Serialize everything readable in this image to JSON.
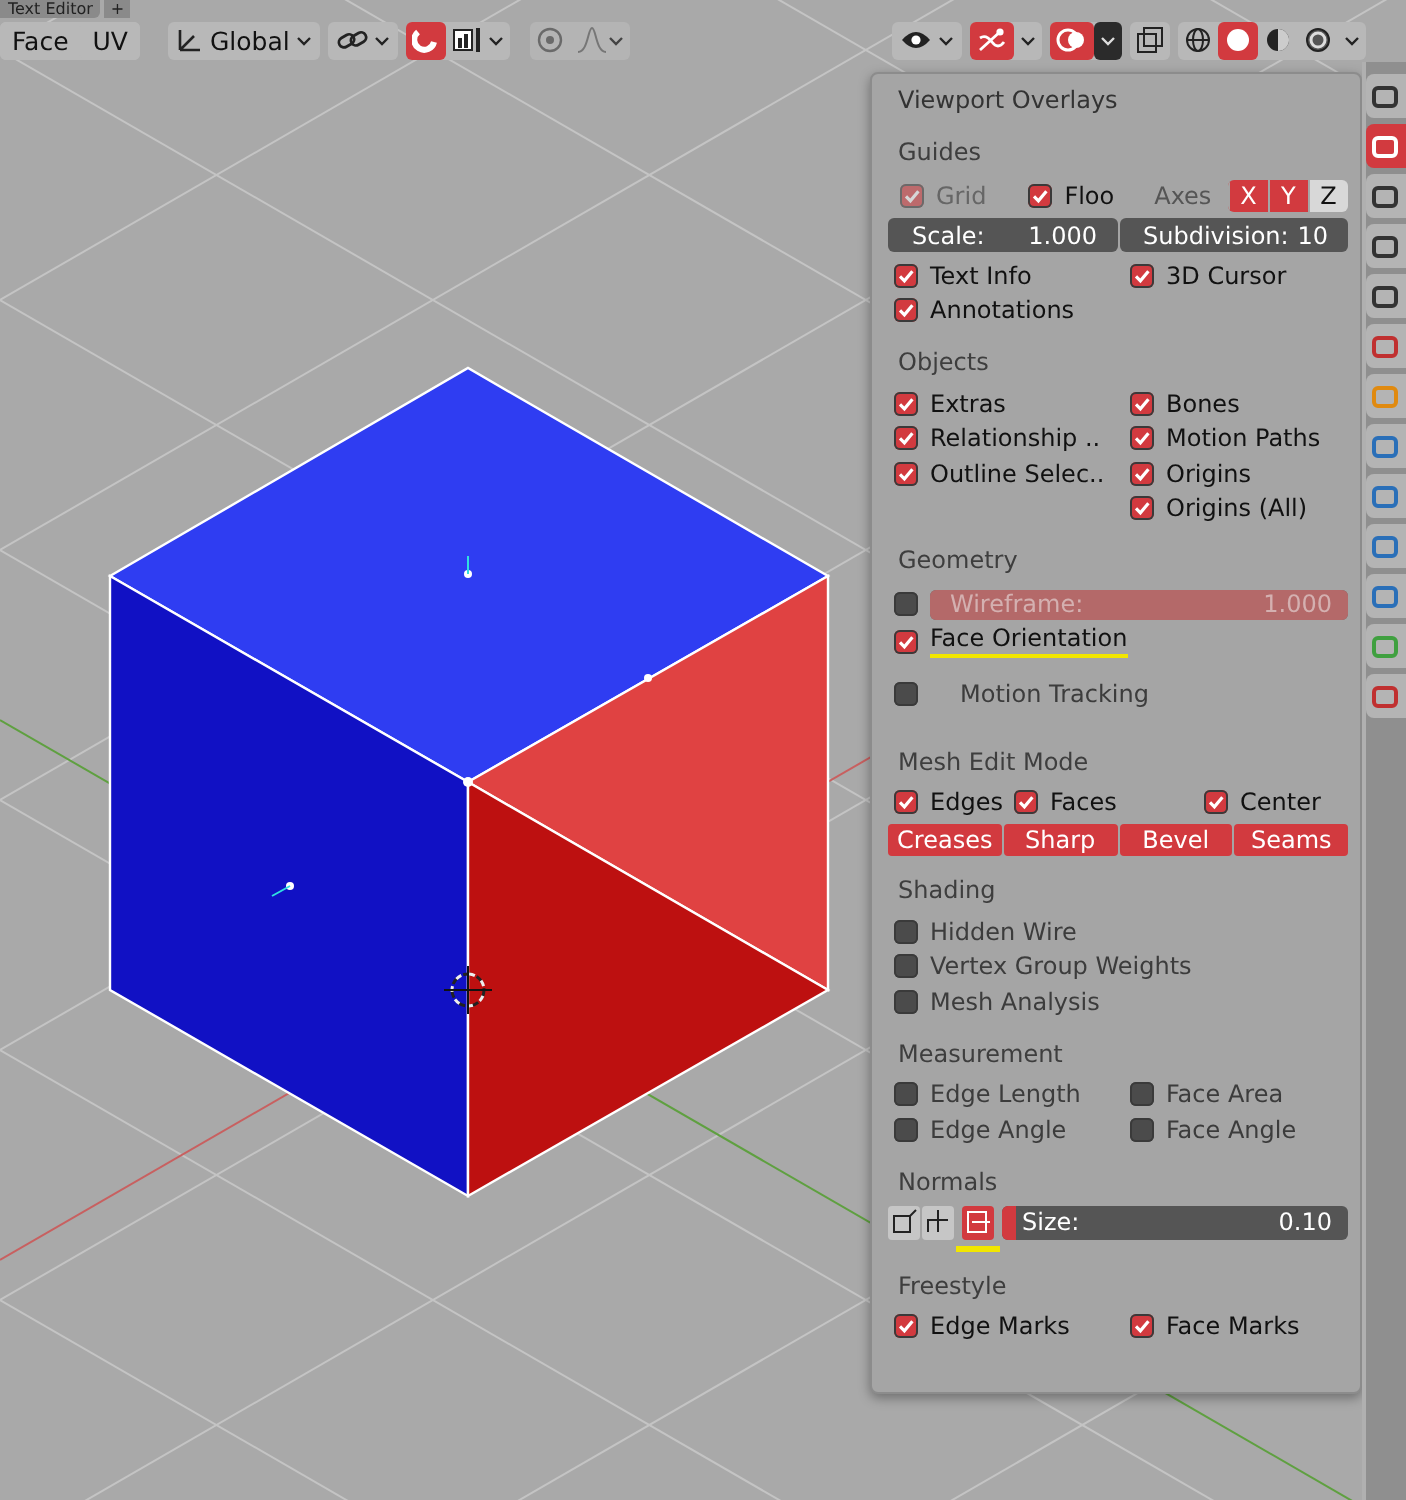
{
  "editor_tabs": [
    {
      "label": "Text Editor"
    }
  ],
  "add_tab": "+",
  "header": {
    "mode_buttons": [
      {
        "label": "Face"
      },
      {
        "label": "UV"
      }
    ],
    "orientation": "Global",
    "snap_on": true,
    "proportional_on": false,
    "gizmos_on": true,
    "overlays_on": true,
    "xray_on": false,
    "shading_modes": [
      {
        "selected": false
      },
      {
        "selected": true
      },
      {
        "selected": false
      },
      {
        "selected": false
      }
    ]
  },
  "overlays": {
    "title": "Viewport Overlays",
    "sections": [
      {
        "title": "Guides",
        "rows": [
          {
            "kind": "guides",
            "grid": {
              "label": "Grid",
              "checked": true,
              "disabled": true
            },
            "floor": {
              "label": "Floo",
              "checked": true,
              "disabled": false
            },
            "axes_label": "Axes",
            "axes": [
              {
                "label": "X",
                "on": true
              },
              {
                "label": "Y",
                "on": true
              },
              {
                "label": "Z",
                "on": false
              }
            ]
          },
          {
            "kind": "fields",
            "fields": [
              {
                "label": "Scale:",
                "value": "1.000"
              },
              {
                "label": "Subdivision:",
                "value": "10"
              }
            ]
          },
          {
            "kind": "checks",
            "items": [
              {
                "label": "Text Info",
                "checked": true
              },
              {
                "label": "3D Cursor",
                "checked": true
              }
            ]
          },
          {
            "kind": "checks",
            "items": [
              {
                "label": "Annotations",
                "checked": true
              }
            ]
          }
        ]
      },
      {
        "title": "Objects",
        "rows": [
          {
            "kind": "columns",
            "columns": [
              [
                {
                  "label": "Extras",
                  "checked": true
                },
                {
                  "label": "Relationship ..",
                  "checked": true
                },
                {
                  "label": "Outline Selec..",
                  "checked": true
                }
              ],
              [
                {
                  "label": "Bones",
                  "checked": true
                },
                {
                  "label": "Motion Paths",
                  "checked": true
                },
                {
                  "label": "Origins",
                  "checked": true
                },
                {
                  "label": "Origins (All)",
                  "checked": true
                }
              ]
            ]
          }
        ]
      },
      {
        "title": "Geometry",
        "rows": [
          {
            "kind": "slider_check",
            "checked": false,
            "label": "Wireframe:",
            "value": "1.000",
            "level": 1,
            "disabled": true
          },
          {
            "kind": "checks",
            "items": [
              {
                "label": "Face Orientation",
                "checked": true,
                "underlined": true
              }
            ]
          },
          {
            "kind": "indented_check",
            "items": [
              {
                "label": "Motion Tracking",
                "checked": false
              }
            ]
          }
        ]
      },
      {
        "title": "Mesh Edit Mode",
        "rows": [
          {
            "kind": "checks",
            "items": [
              {
                "label": "Edges",
                "checked": true
              },
              {
                "label": "Faces",
                "checked": true
              },
              {
                "label": "Center",
                "checked": true
              }
            ]
          },
          {
            "kind": "toggles",
            "buttons": [
              {
                "label": "Creases",
                "on": true
              },
              {
                "label": "Sharp",
                "on": true
              },
              {
                "label": "Bevel",
                "on": true
              },
              {
                "label": "Seams",
                "on": true
              }
            ]
          }
        ]
      },
      {
        "title": "Shading",
        "rows": [
          {
            "kind": "checks",
            "items": [
              {
                "label": "Hidden Wire",
                "checked": false
              }
            ]
          },
          {
            "kind": "checks",
            "items": [
              {
                "label": "Vertex Group Weights",
                "checked": false
              }
            ]
          },
          {
            "kind": "checks",
            "items": [
              {
                "label": "Mesh Analysis",
                "checked": false
              }
            ]
          }
        ]
      },
      {
        "title": "Measurement",
        "rows": [
          {
            "kind": "checks",
            "items": [
              {
                "label": "Edge Length",
                "checked": false
              },
              {
                "label": "Face Area",
                "checked": false
              }
            ]
          },
          {
            "kind": "checks",
            "items": [
              {
                "label": "Edge Angle",
                "checked": false
              },
              {
                "label": "Face Angle",
                "checked": false
              }
            ]
          }
        ]
      },
      {
        "title": "Normals",
        "rows": [
          {
            "kind": "normals",
            "modes": [
              {
                "selected": false,
                "underlined": false
              },
              {
                "selected": false,
                "underlined": false
              },
              {
                "selected": true,
                "underlined": true
              }
            ],
            "label": "Size:",
            "value": "0.10",
            "level": 0.04
          }
        ]
      },
      {
        "title": "Freestyle",
        "rows": [
          {
            "kind": "checks",
            "items": [
              {
                "label": "Edge Marks",
                "checked": true
              },
              {
                "label": "Face Marks",
                "checked": true
              }
            ]
          }
        ]
      }
    ]
  },
  "properties_tabs": [
    {
      "selected": false
    },
    {
      "selected": true
    },
    {
      "selected": false
    },
    {
      "selected": false
    },
    {
      "selected": false
    },
    {
      "selected": false
    },
    {
      "selected": false
    },
    {
      "selected": false
    },
    {
      "selected": false
    },
    {
      "selected": false
    },
    {
      "selected": false
    },
    {
      "selected": false
    },
    {
      "selected": false
    }
  ]
}
